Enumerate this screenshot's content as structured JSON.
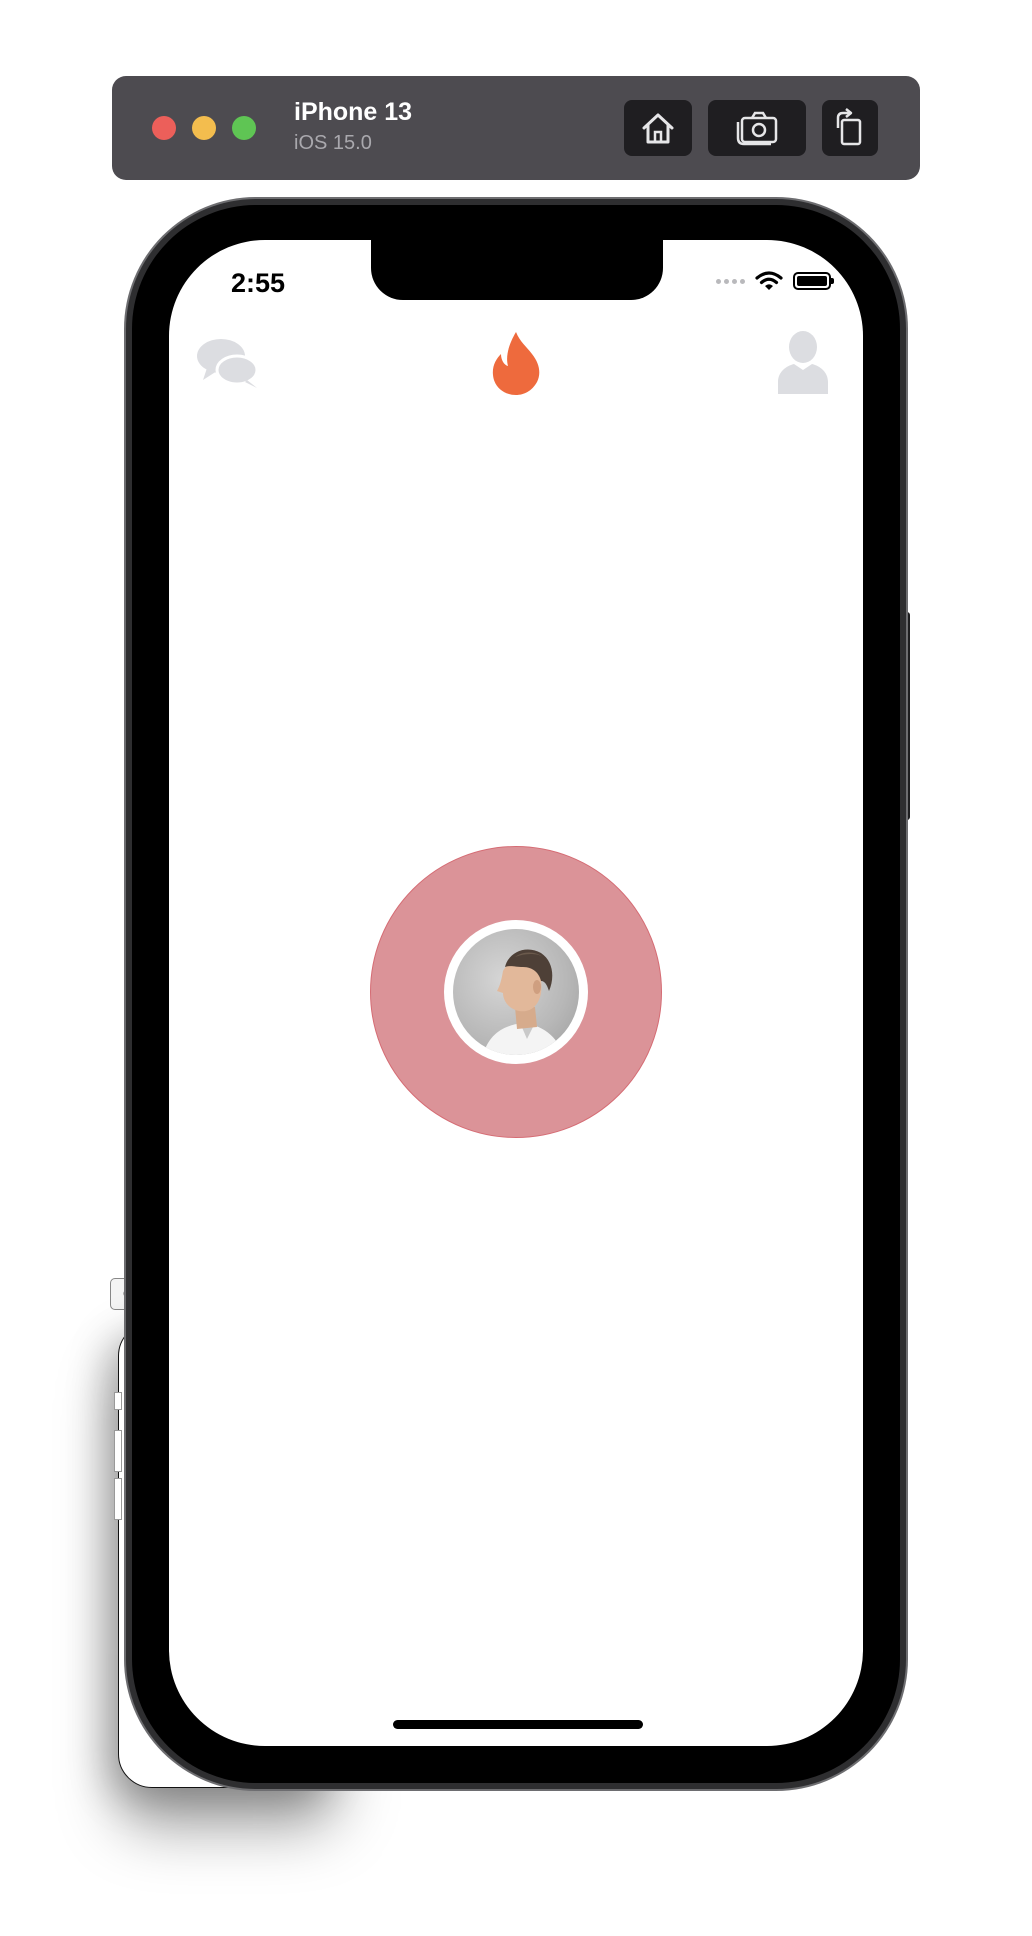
{
  "simulator": {
    "device_name": "iPhone 13",
    "os_version": "iOS 15.0",
    "buttons": {
      "home_icon": "home-icon",
      "screenshot_icon": "camera-icon",
      "rotate_icon": "rotate-icon"
    }
  },
  "status_bar": {
    "time": "2:55",
    "wifi_icon": "wifi-icon",
    "battery_icon": "battery-icon"
  },
  "nav_bar": {
    "left_icon": "chat-bubbles-icon",
    "center_icon": "flame-icon",
    "right_icon": "profile-icon"
  },
  "colors": {
    "accent_flame": "#ee6a3d",
    "pulse_fill": "#db9398",
    "pulse_border": "#d56c74",
    "icon_gray": "#dcdde1",
    "toolbar_bg": "#4d4b50"
  },
  "main": {
    "avatar_icon": "user-photo"
  }
}
